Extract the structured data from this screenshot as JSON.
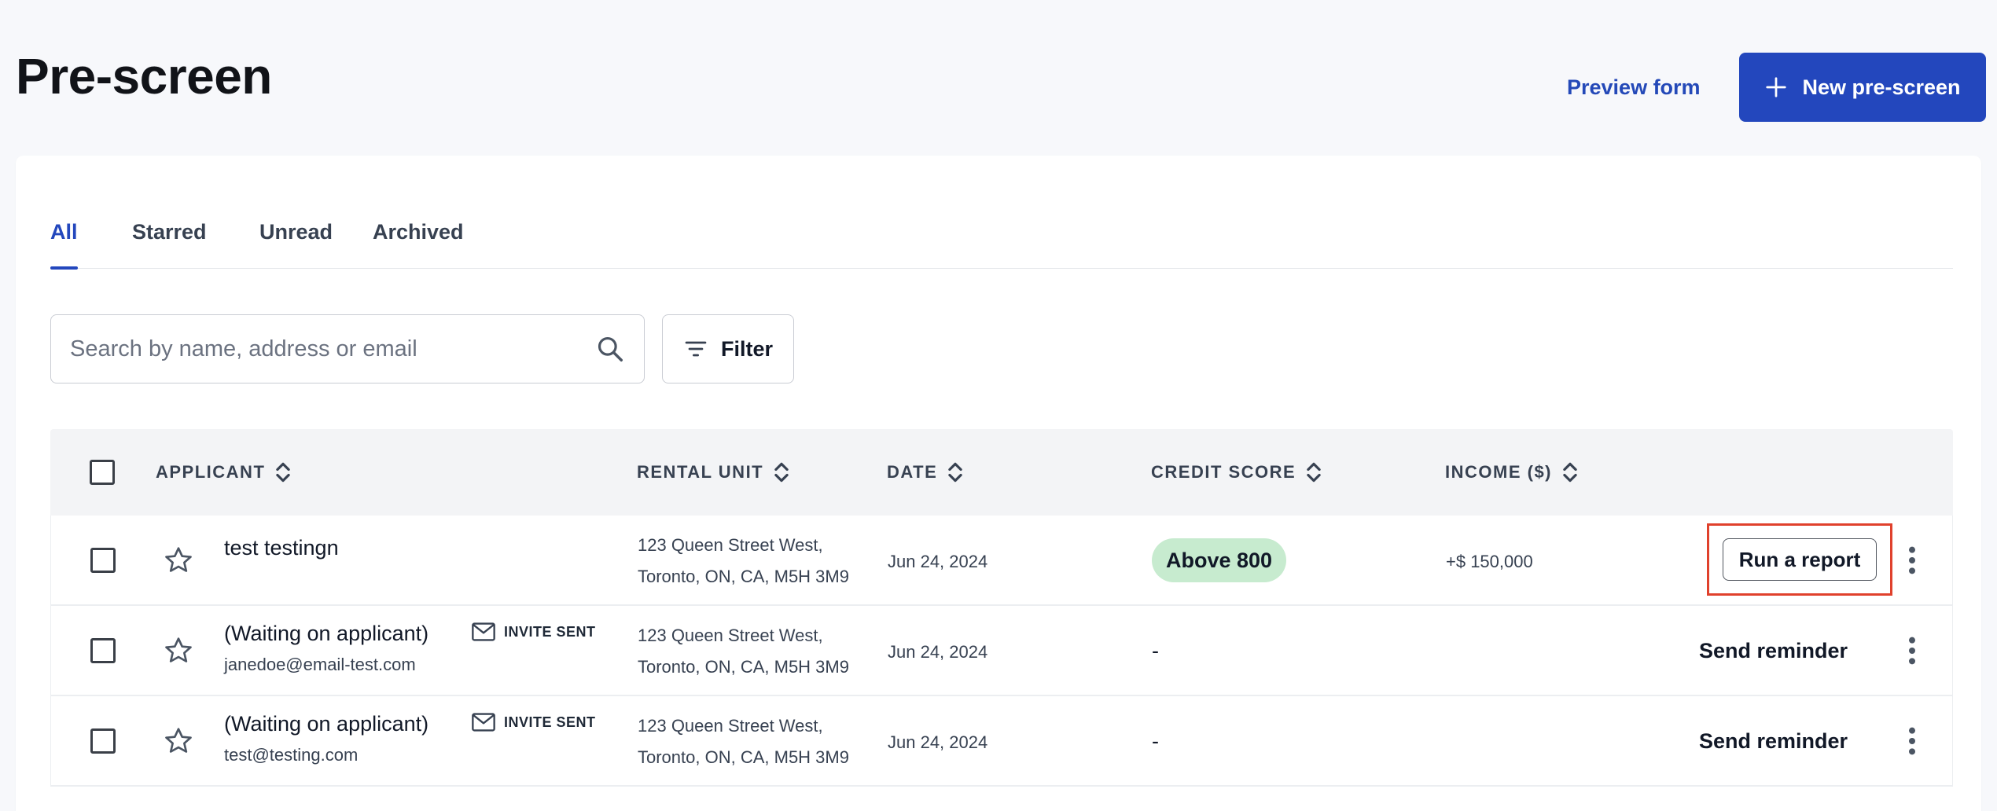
{
  "page": {
    "title": "Pre-screen"
  },
  "header": {
    "preview_label": "Preview form",
    "new_label": "New pre-screen"
  },
  "tabs": [
    {
      "label": "All",
      "active": true
    },
    {
      "label": "Starred",
      "active": false
    },
    {
      "label": "Unread",
      "active": false
    },
    {
      "label": "Archived",
      "active": false
    }
  ],
  "search": {
    "placeholder": "Search by name, address or email",
    "value": ""
  },
  "filter": {
    "label": "Filter"
  },
  "columns": {
    "applicant": "APPLICANT",
    "rental_unit": "RENTAL UNIT",
    "date": "DATE",
    "credit_score": "CREDIT SCORE",
    "income": "INCOME ($)"
  },
  "rows": [
    {
      "name": "test testingn",
      "email": "",
      "invite": "",
      "address_line1": "123 Queen Street West,",
      "address_line2": "Toronto, ON, CA, M5H 3M9",
      "date": "Jun 24, 2024",
      "credit": "Above 800",
      "income": "+$ 150,000",
      "action": "Run a report"
    },
    {
      "name": "(Waiting on applicant)",
      "email": "janedoe@email-test.com",
      "invite": "INVITE SENT",
      "address_line1": "123 Queen Street West,",
      "address_line2": "Toronto, ON, CA, M5H 3M9",
      "date": "Jun 24, 2024",
      "credit": "-",
      "income": "",
      "action": "Send reminder"
    },
    {
      "name": "(Waiting on applicant)",
      "email": "test@testing.com",
      "invite": "INVITE SENT",
      "address_line1": "123 Queen Street West,",
      "address_line2": "Toronto, ON, CA, M5H 3M9",
      "date": "Jun 24, 2024",
      "credit": "-",
      "income": "",
      "action": "Send reminder"
    }
  ],
  "icons": {
    "plus": "plus-icon",
    "search": "search-icon",
    "filter": "filter-icon",
    "sort": "sort-icon",
    "star": "star-outline-icon",
    "mail": "mail-icon",
    "more": "more-vertical-icon"
  },
  "colors": {
    "primary": "#2347bd",
    "badge_green": "#c7ebcf",
    "highlight_red": "#e0412c",
    "background": "#f7f8fb"
  }
}
